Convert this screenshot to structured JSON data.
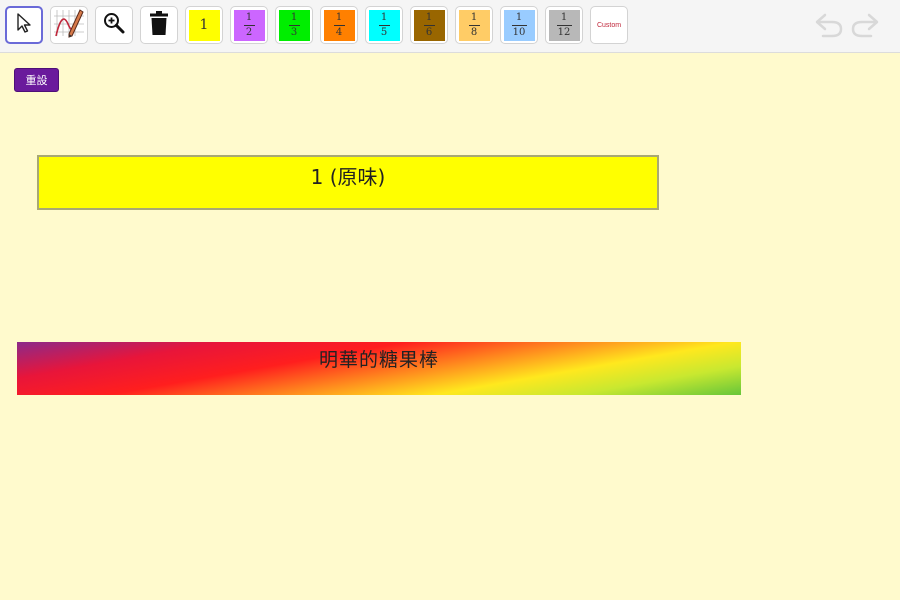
{
  "toolbar": {
    "tools": [
      {
        "name": "move-tool",
        "icon": "pointer-arrow-icon"
      },
      {
        "name": "pen-tool",
        "icon": "pen-graph-icon"
      },
      {
        "name": "zoom-tool",
        "icon": "zoom-in-icon"
      },
      {
        "name": "delete-tool",
        "icon": "trash-icon"
      }
    ],
    "fractions": [
      {
        "label": "1",
        "numerator": "1",
        "denominator": "",
        "color": "#ffff00"
      },
      {
        "label": "1/2",
        "numerator": "1",
        "denominator": "2",
        "color": "#cc66ff"
      },
      {
        "label": "1/3",
        "numerator": "1",
        "denominator": "3",
        "color": "#00ee00"
      },
      {
        "label": "1/4",
        "numerator": "1",
        "denominator": "4",
        "color": "#ff8000"
      },
      {
        "label": "1/5",
        "numerator": "1",
        "denominator": "5",
        "color": "#00ffff"
      },
      {
        "label": "1/6",
        "numerator": "1",
        "denominator": "6",
        "color": "#996600"
      },
      {
        "label": "1/8",
        "numerator": "1",
        "denominator": "8",
        "color": "#ffcc66"
      },
      {
        "label": "1/10",
        "numerator": "1",
        "denominator": "10",
        "color": "#99ccff"
      },
      {
        "label": "1/12",
        "numerator": "1",
        "denominator": "12",
        "color": "#b8b8b8"
      }
    ],
    "custom_label": "Custom",
    "undo_icon": "undo-icon",
    "redo_icon": "redo-icon"
  },
  "reset_button": {
    "label": "重設",
    "color": "#6a1a9c"
  },
  "canvas": {
    "whole_bar": {
      "label": "1 (原味)",
      "color": "#ffff00"
    },
    "candy_bar": {
      "label": "明華的糖果棒"
    }
  },
  "colors": {
    "canvas_background": "#fffacd",
    "toolbar_background": "#f5f5f5",
    "selected_border": "#6a6ad8"
  }
}
